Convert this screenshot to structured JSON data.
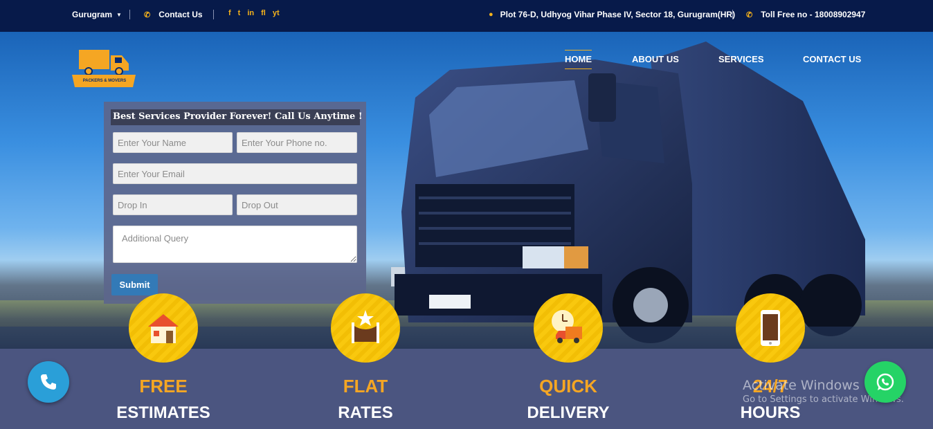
{
  "topbar": {
    "city": "Gurugram",
    "contact": "Contact Us",
    "address": "Plot 76-D, Udhyog Vihar Phase IV, Sector 18, Gurugram(HR)",
    "tollfree": "Toll Free no - 18008902947",
    "social": [
      "f",
      "t",
      "in",
      "fl",
      "yt"
    ]
  },
  "logo": {
    "text": "PACKERS & MOVERS"
  },
  "nav": [
    "HOME",
    "ABOUT US",
    "SERVICES",
    "CONTACT US"
  ],
  "form": {
    "title": "Best Services Provider Forever! Call Us Anytime !",
    "name_placeholder": "Enter Your Name",
    "phone_placeholder": "Enter Your Phone no.",
    "email_placeholder": "Enter Your Email",
    "dropin_placeholder": "Drop In",
    "dropout_placeholder": "Drop Out",
    "query_placeholder": "Additional Query",
    "submit": "Submit"
  },
  "features": [
    {
      "line1": "FREE",
      "line2": "ESTIMATES",
      "icon": "house-icon"
    },
    {
      "line1": "FLAT",
      "line2": "RATES",
      "icon": "star-podium-icon"
    },
    {
      "line1": "QUICK",
      "line2": "DELIVERY",
      "icon": "clock-truck-icon"
    },
    {
      "line1": "24/7",
      "line2": "HOURS",
      "icon": "phone-icon"
    }
  ],
  "watermark": {
    "line1": "Activate Windows",
    "line2": "Go to Settings to activate Windows."
  },
  "colors": {
    "accent": "#f5b21b",
    "topbar": "#071a4a",
    "band": "#4b5580",
    "button": "#337ab7"
  }
}
